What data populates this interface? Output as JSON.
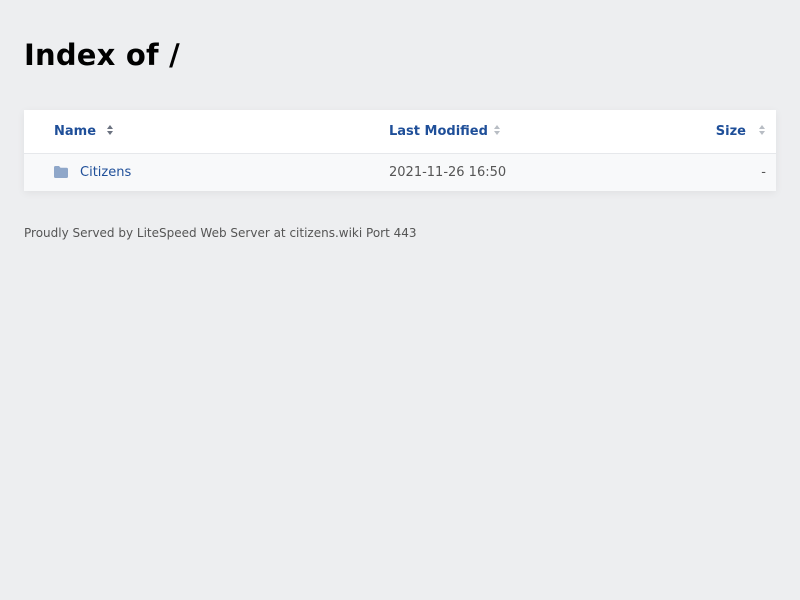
{
  "page": {
    "title": "Index of /"
  },
  "table": {
    "columns": {
      "name": "Name",
      "last_modified": "Last Modified",
      "size": "Size"
    },
    "rows": [
      {
        "icon": "folder-icon",
        "name": "Citizens",
        "last_modified": "2021-11-26 16:50",
        "size": "-"
      }
    ]
  },
  "footer": {
    "text": "Proudly Served by LiteSpeed Web Server at citizens.wiki Port 443"
  },
  "colors": {
    "background": "#edeef0",
    "link": "#1f4f99",
    "folder": "#8fa7c9"
  }
}
